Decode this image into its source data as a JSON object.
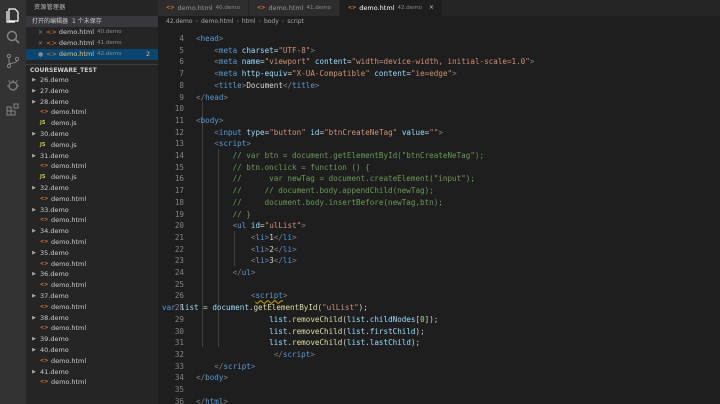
{
  "sidebar": {
    "title": "资源管理器",
    "open_editors": {
      "header": "打开的编辑器",
      "count": "1 个未保存",
      "items": [
        {
          "name": "demo.html",
          "dir": "40.demo",
          "badge": ""
        },
        {
          "name": "demo.html",
          "dir": "41.demo",
          "badge": ""
        },
        {
          "name": "demo.html",
          "dir": "42.demo",
          "badge": "2"
        }
      ]
    },
    "project": {
      "name": "COURSEWARE_TEST",
      "tree": [
        {
          "label": "26.demo",
          "kind": "folder"
        },
        {
          "label": "27.demo",
          "kind": "folder"
        },
        {
          "label": "28.demo",
          "kind": "folder"
        },
        {
          "label": "demo.html",
          "kind": "html"
        },
        {
          "label": "demo.js",
          "kind": "js"
        },
        {
          "label": "30.demo",
          "kind": "folder"
        },
        {
          "label": "demo.js",
          "kind": "js"
        },
        {
          "label": "31.demo",
          "kind": "folder"
        },
        {
          "label": "demo.html",
          "kind": "html"
        },
        {
          "label": "demo.js",
          "kind": "js"
        },
        {
          "label": "32.demo",
          "kind": "folder"
        },
        {
          "label": "demo.html",
          "kind": "html"
        },
        {
          "label": "33.demo",
          "kind": "folder"
        },
        {
          "label": "demo.html",
          "kind": "html"
        },
        {
          "label": "34.demo",
          "kind": "folder"
        },
        {
          "label": "demo.html",
          "kind": "html"
        },
        {
          "label": "35.demo",
          "kind": "folder"
        },
        {
          "label": "demo.html",
          "kind": "html"
        },
        {
          "label": "36.demo",
          "kind": "folder"
        },
        {
          "label": "demo.html",
          "kind": "html"
        },
        {
          "label": "37.demo",
          "kind": "folder"
        },
        {
          "label": "demo.html",
          "kind": "html"
        },
        {
          "label": "38.demo",
          "kind": "folder"
        },
        {
          "label": "demo.html",
          "kind": "html"
        },
        {
          "label": "39.demo",
          "kind": "folder"
        },
        {
          "label": "40.demo",
          "kind": "folder"
        },
        {
          "label": "demo.html",
          "kind": "html"
        },
        {
          "label": "41.demo",
          "kind": "folder"
        },
        {
          "label": "demo.html",
          "kind": "html"
        }
      ]
    }
  },
  "tabs": [
    {
      "name": "demo.html",
      "dir": "40.demo",
      "active": false
    },
    {
      "name": "demo.html",
      "dir": "41.demo",
      "active": false
    },
    {
      "name": "demo.html",
      "dir": "42.demo",
      "active": true
    }
  ],
  "breadcrumb": [
    "42.demo",
    "demo.html",
    "html",
    "body",
    "script"
  ],
  "code_lines": [
    {
      "n": "4",
      "html": "<span class='pt'>&lt;</span><span class='tg'>head</span><span class='pt'>&gt;</span>"
    },
    {
      "n": "5",
      "html": "    <span class='pt'>&lt;</span><span class='tg'>meta</span> <span class='at'>charset</span><span class='tx'>=</span><span class='st'>\"UTF-8\"</span><span class='pt'>&gt;</span>"
    },
    {
      "n": "6",
      "html": "    <span class='pt'>&lt;</span><span class='tg'>meta</span> <span class='at'>name</span><span class='tx'>=</span><span class='st'>\"viewport\"</span> <span class='at'>content</span><span class='tx'>=</span><span class='st'>\"width=device-width, initial-scale=1.0\"</span><span class='pt'>&gt;</span>"
    },
    {
      "n": "7",
      "html": "    <span class='pt'>&lt;</span><span class='tg'>meta</span> <span class='at'>http-equiv</span><span class='tx'>=</span><span class='st'>\"X-UA-Compatible\"</span> <span class='at'>content</span><span class='tx'>=</span><span class='st'>\"ie=edge\"</span><span class='pt'>&gt;</span>"
    },
    {
      "n": "8",
      "html": "    <span class='pt'>&lt;</span><span class='tg'>title</span><span class='pt'>&gt;</span><span class='tx'>Document</span><span class='pt'>&lt;/</span><span class='tg'>title</span><span class='pt'>&gt;</span>"
    },
    {
      "n": "9",
      "html": "<span class='pt'>&lt;/</span><span class='tg'>head</span><span class='pt'>&gt;</span>"
    },
    {
      "n": "10",
      "html": ""
    },
    {
      "n": "11",
      "html": "<span class='pt'>&lt;</span><span class='tg'>body</span><span class='pt'>&gt;</span>"
    },
    {
      "n": "12",
      "html": "    <span class='pt'>&lt;</span><span class='tg'>input</span> <span class='at'>type</span><span class='tx'>=</span><span class='st'>\"button\"</span> <span class='at'>id</span><span class='tx'>=</span><span class='st'>\"btnCreateNeTag\"</span> <span class='at'>value</span><span class='tx'>=</span><span class='st'>\"\"</span><span class='pt'>&gt;</span>"
    },
    {
      "n": "13",
      "html": "    <span class='pt'>&lt;</span><span class='tg'>script</span><span class='pt'>&gt;</span>"
    },
    {
      "n": "14",
      "html": "        <span class='cm'>// var btn = document.getElementById(\"btnCreateNeTag\");</span>"
    },
    {
      "n": "15",
      "html": "        <span class='cm'>// btn.onclick = function () {</span>"
    },
    {
      "n": "16",
      "html": "        <span class='cm'>//      var newTag = document.createElement(\"input\");</span>"
    },
    {
      "n": "17",
      "html": "        <span class='cm'>//     // document.body.appendChild(newTag);</span>"
    },
    {
      "n": "18",
      "html": "        <span class='cm'>//     document.body.insertBefore(newTag,btn);</span>"
    },
    {
      "n": "19",
      "html": "        <span class='cm'>// }</span>"
    },
    {
      "n": "20",
      "html": "        <span class='pt'>&lt;</span><span class='tg'>ul</span> <span class='at'>id</span><span class='tx'>=</span><span class='st'>\"ulList\"</span><span class='pt'>&gt;</span>"
    },
    {
      "n": "21",
      "html": "            <span class='pt'>&lt;</span><span class='tg'>li</span><span class='pt'>&gt;</span><span class='tx'>1</span><span class='pt'>&lt;/</span><span class='tg'>li</span><span class='pt'>&gt;</span>"
    },
    {
      "n": "22",
      "html": "            <span class='pt'>&lt;</span><span class='tg'>li</span><span class='pt'>&gt;</span><span class='tx'>2</span><span class='pt'>&lt;/</span><span class='tg'>li</span><span class='pt'>&gt;</span>"
    },
    {
      "n": "23",
      "html": "            <span class='pt'>&lt;</span><span class='tg'>li</span><span class='pt'>&gt;</span><span class='tx'>3</span><span class='pt'>&lt;/</span><span class='tg'>li</span><span class='pt'>&gt;</span>"
    },
    {
      "n": "24",
      "html": "        <span class='pt'>&lt;/</span><span class='tg'>ul</span><span class='pt'>&gt;</span>"
    },
    {
      "n": "25",
      "html": ""
    },
    {
      "n": "26",
      "html": "            <span class='pt'>&lt;</span><span class='tg squig'>script</span><span class='pt'>&gt;</span>"
    },
    {
      "n": "28",
      "html": "<span class='kw'>var</span> <span class='vr'>list</span> <span class='tx'>=</span> <span class='vr'>document</span><span class='tx'>.</span><span class='fn'>getElementById</span><span class='tx'>(</span><span class='st'>\"ulList\"</span><span class='tx'>);</span>"
    },
    {
      "n": "29",
      "html": "                <span class='vr'>list</span><span class='tx'>.</span><span class='fn'>removeChild</span><span class='tx'>(</span><span class='vr'>list</span><span class='tx'>.</span><span class='vr'>childNodes</span><span class='tx'>[</span><span class='nm'>0</span><span class='tx'>]);</span>"
    },
    {
      "n": "30",
      "html": "                <span class='vr'>list</span><span class='tx'>.</span><span class='fn'>removeChild</span><span class='tx'>(</span><span class='vr'>list</span><span class='tx'>.</span><span class='vr'>firstChild</span><span class='tx'>);</span>"
    },
    {
      "n": "31",
      "html": "                <span class='vr'>list</span><span class='tx'>.</span><span class='fn'>removeChild</span><span class='tx'>(</span><span class='vr'>list</span><span class='tx'>.</span><span class='vr'>lastChild</span><span class='tx'>);</span>"
    },
    {
      "n": "32",
      "html": "                 <span class='pt'>&lt;/</span><span class='tg'>script</span><span class='pt'>&gt;</span>"
    },
    {
      "n": "33",
      "html": "    <span class='pt'>&lt;/</span><span class='tg'>script</span><span class='pt'>&gt;</span>"
    },
    {
      "n": "34",
      "html": "<span class='pt'>&lt;/</span><span class='tg'>body</span><span class='pt'>&gt;</span>"
    },
    {
      "n": "35",
      "html": ""
    },
    {
      "n": "36",
      "html": "<span class='pt'>&lt;/</span><span class='tg'>html</span><span class='pt'>&gt;</span>"
    }
  ]
}
